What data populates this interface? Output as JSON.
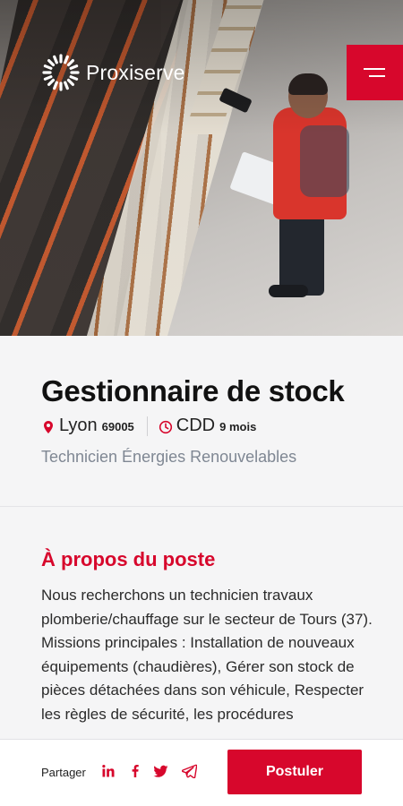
{
  "brand": {
    "name": "Proxiserve",
    "accent": "#d7072c"
  },
  "menu": {
    "icon": "hamburger-menu-icon"
  },
  "job": {
    "title": "Gestionnaire de stock",
    "location_icon": "location-pin-icon",
    "city": "Lyon",
    "postcode": "69005",
    "contract_icon": "clock-icon",
    "contract": "CDD",
    "duration": "9 mois",
    "category": "Technicien Énergies Renouvelables"
  },
  "about": {
    "title": "À propos du poste",
    "text": "Nous recherchons un technicien travaux plomberie/chauffage sur le secteur de Tours (37). Missions principales : Installation de nouveaux équipements (chaudières), Gérer son stock de pièces détachées dans son véhicule, Respecter les règles de sécurité, les procédures"
  },
  "footer": {
    "share_label": "Partager",
    "share_icons": [
      "linkedin-icon",
      "facebook-icon",
      "twitter-icon",
      "telegram-icon"
    ],
    "apply_label": "Postuler"
  }
}
